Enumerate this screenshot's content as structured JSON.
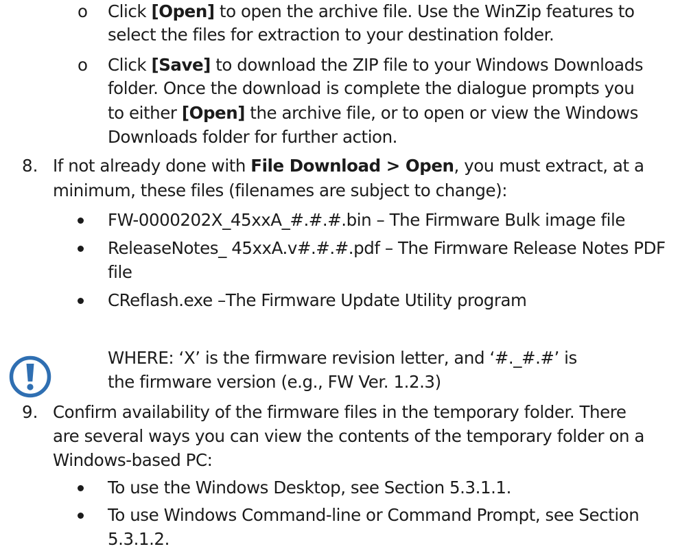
{
  "sub_items": [
    {
      "marker": "o",
      "lines": [
        [
          "Click ",
          {
            "b": "[Open]"
          },
          " to open the archive file. Use the WinZip features to"
        ],
        [
          "select the files for extraction to your destination folder."
        ]
      ]
    },
    {
      "marker": "o",
      "lines": [
        [
          "Click ",
          {
            "b": "[Save]"
          },
          " to download the ZIP file to your Windows Downloads"
        ],
        [
          "folder. Once the download is complete the dialogue prompts you"
        ],
        [
          "to either ",
          {
            "b": "[Open]"
          },
          " the archive file, or to open or view the Windows"
        ],
        [
          "Downloads folder for further action."
        ]
      ]
    }
  ],
  "step8": {
    "number": "8.",
    "lines": [
      [
        "If not already done with ",
        {
          "b": "File Download > Open"
        },
        ", you must extract, at a"
      ],
      [
        "minimum, these files (filenames are subject to change):"
      ]
    ],
    "bullets": [
      {
        "lines": [
          "FW-0000202X_45xxA_#.#.#.bin – The Firmware Bulk image file"
        ]
      },
      {
        "lines": [
          "ReleaseNotes_ 45xxA.v#.#.#.pdf – The Firmware Release Notes PDF",
          "file"
        ]
      },
      {
        "lines": [
          "CReflash.exe –The Firmware Update Utility program"
        ]
      }
    ]
  },
  "note": {
    "icon": "exclamation-circle-icon",
    "color": "#2f6fb2",
    "lines": [
      "WHERE: ‘X’ is the firmware revision letter, and ‘#._#.#’ is",
      "the firmware version (e.g., FW Ver. 1.2.3)"
    ]
  },
  "step9": {
    "number": "9.",
    "lines": [
      "Confirm availability of the firmware files in the temporary folder. There",
      "are several ways you can view the contents of the temporary folder on a",
      "Windows-based PC:"
    ],
    "bullets": [
      {
        "lines": [
          "To use the Windows Desktop, see Section 5.3.1.1."
        ]
      },
      {
        "lines": [
          "To use Windows Command-line or Command Prompt, see Section",
          "5.3.1.2."
        ]
      }
    ]
  }
}
